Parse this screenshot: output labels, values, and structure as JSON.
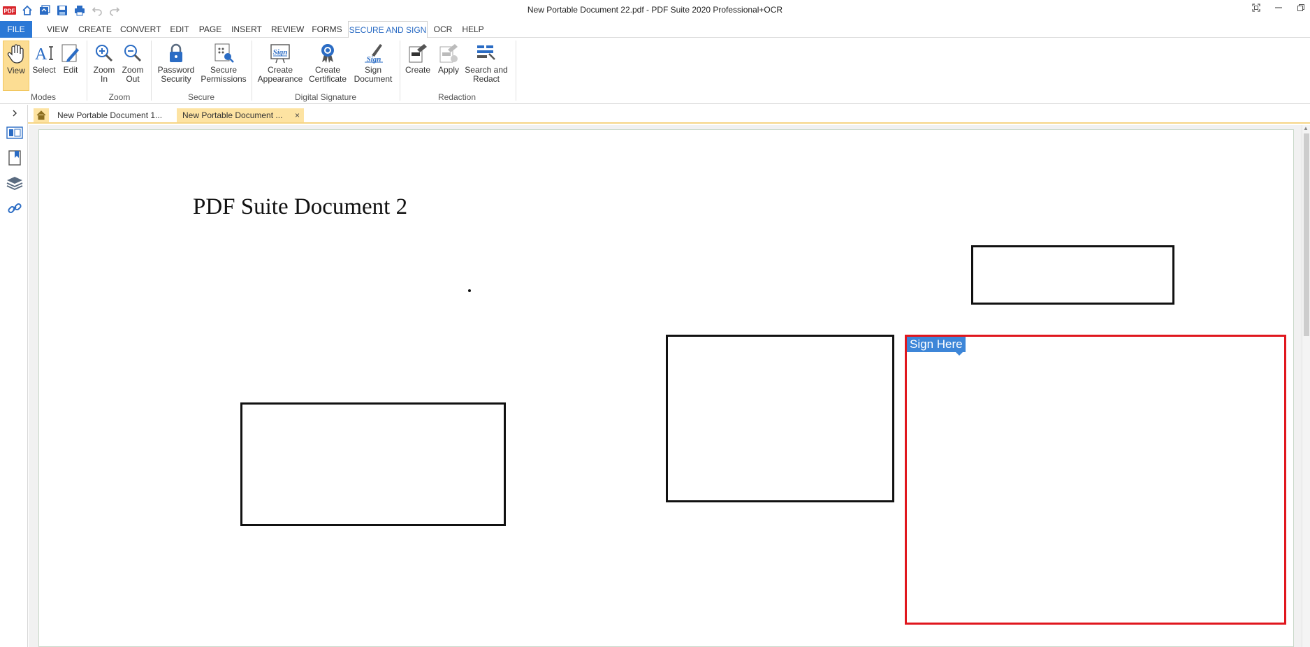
{
  "window": {
    "title": "New Portable Document 22.pdf    -    PDF Suite 2020  Professional+OCR",
    "controls": [
      "restore-icon",
      "minimize-icon",
      "maximize-icon"
    ]
  },
  "quick_access": [
    "pdf-logo-icon",
    "home-icon",
    "open-icon",
    "save-icon",
    "print-icon",
    "undo-icon",
    "redo-icon"
  ],
  "menu": {
    "file": "FILE",
    "view": "VIEW",
    "create": "CREATE",
    "convert": "CONVERT",
    "edit": "EDIT",
    "page": "PAGE",
    "insert": "INSERT",
    "review": "REVIEW",
    "forms": "FORMS",
    "secure_and_sign": "SECURE AND SIGN",
    "ocr": "OCR",
    "help": "HELP"
  },
  "ribbon": {
    "modes": {
      "label": "Modes",
      "view": "View",
      "select": "Select",
      "edit": "Edit"
    },
    "zoom": {
      "label": "Zoom",
      "zoom_in_1": "Zoom",
      "zoom_in_2": "In",
      "zoom_out_1": "Zoom",
      "zoom_out_2": "Out"
    },
    "secure": {
      "label": "Secure",
      "password_1": "Password",
      "password_2": "Security",
      "permissions_1": "Secure",
      "permissions_2": "Permissions"
    },
    "digital_signature": {
      "label": "Digital Signature",
      "appearance_1": "Create",
      "appearance_2": "Appearance",
      "certificate_1": "Create",
      "certificate_2": "Certificate",
      "sign_1": "Sign",
      "sign_2": "Document"
    },
    "redaction": {
      "label": "Redaction",
      "create": "Create",
      "apply": "Apply",
      "search_1": "Search and",
      "search_2": "Redact"
    }
  },
  "doc_tabs": {
    "tab1": "New Portable Document 1...",
    "tab2": "New Portable Document ...",
    "close": "×"
  },
  "document": {
    "title": "PDF Suite Document 2",
    "sign_label": "Sign Here"
  },
  "colors": {
    "accent": "#2b78d6",
    "selected_tab": "#fde3a2",
    "signature_border": "#e0171e",
    "sign_tag": "#3d86d8"
  }
}
